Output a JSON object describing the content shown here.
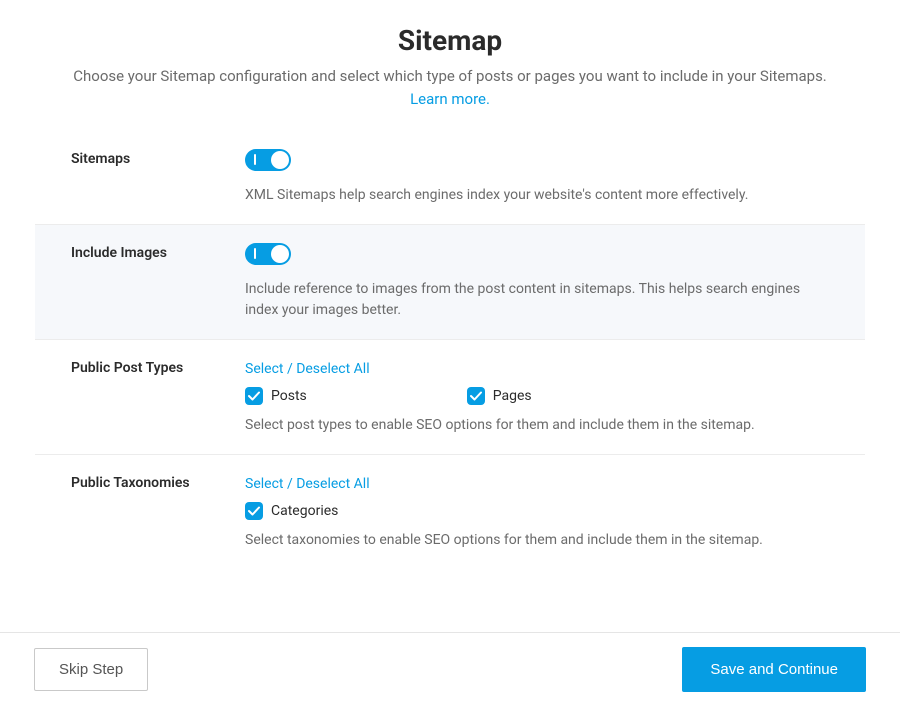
{
  "header": {
    "title": "Sitemap",
    "description_part1": "Choose your Sitemap configuration and select which type of posts or pages you want to include in your Sitemaps. ",
    "learn_more": "Learn more."
  },
  "sections": {
    "sitemaps": {
      "label": "Sitemaps",
      "enabled": true,
      "help": "XML Sitemaps help search engines index your website's content more effectively."
    },
    "include_images": {
      "label": "Include Images",
      "enabled": true,
      "help": "Include reference to images from the post content in sitemaps. This helps search engines index your images better."
    },
    "public_post_types": {
      "label": "Public Post Types",
      "select_all": "Select / Deselect All",
      "items": [
        {
          "label": "Posts",
          "checked": true
        },
        {
          "label": "Pages",
          "checked": true
        }
      ],
      "help": "Select post types to enable SEO options for them and include them in the sitemap."
    },
    "public_taxonomies": {
      "label": "Public Taxonomies",
      "select_all": "Select / Deselect All",
      "items": [
        {
          "label": "Categories",
          "checked": true
        }
      ],
      "help": "Select taxonomies to enable SEO options for them and include them in the sitemap."
    }
  },
  "footer": {
    "skip": "Skip Step",
    "save": "Save and Continue"
  }
}
